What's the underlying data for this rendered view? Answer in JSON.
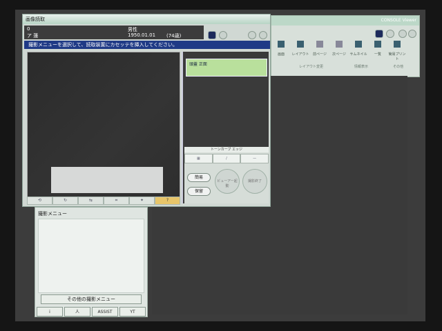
{
  "dialog": {
    "title": "画像読取",
    "patient_id": "0",
    "patient_name": "ア 蓮",
    "sex": "男性",
    "birthdate": "1950.01.01",
    "age": "(74歳)",
    "message": "撮影メニューを選択して、読取装置にカセッテを挿入してください。",
    "protocol_label": "頭蓋 正面",
    "lower_strip": "トーンカーブ   エッジ",
    "button_kantan": "簡易",
    "button_hogo": "保留",
    "button_start": "ビューアー起動",
    "button_end": "撮影終了"
  },
  "viewer": {
    "title": "CONSOLE Viewer",
    "toolbar": [
      {
        "label": "画面"
      },
      {
        "label": "レイアウト"
      },
      {
        "label": "前ページ"
      },
      {
        "label": "次ページ"
      },
      {
        "label": "サムネイル"
      },
      {
        "label": "一覧"
      },
      {
        "label": "簡易プリント"
      }
    ],
    "groups": {
      "layout": "レイアウト変更",
      "display": "情報表示",
      "other": "その他"
    }
  },
  "menu_panel": {
    "title": "撮影メニュー",
    "other_menu": "その他の撮影メニュー",
    "footer": [
      "i",
      "人",
      "ASSIST",
      "YT"
    ]
  },
  "colors": {
    "accent": "#1f3a86",
    "protocol": "#b9e09c",
    "title": "#b7d4c4"
  }
}
